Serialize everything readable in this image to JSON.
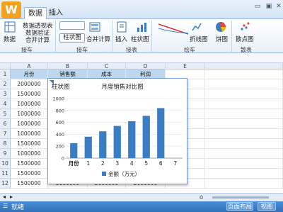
{
  "app": {
    "logo_letter": "W"
  },
  "tabs": [
    {
      "label": "数据"
    },
    {
      "label": "插入"
    }
  ],
  "ribbon": {
    "data_btn": "数据",
    "pivot": "数据透视表",
    "validate": "数据验证",
    "merge_calc_top": "合并计算",
    "group_label_1": "接车",
    "gen_graph": "柱状图",
    "merge_calc": "合并计算",
    "group_label_2": "接车",
    "insert": "插入",
    "bar_chart": "柱状图",
    "group_label_3": "接表",
    "line_chart": "折线图",
    "pie_chart": "饼图",
    "group_label_4": "绘车",
    "scatter": "散点图",
    "group_label_5": "散表"
  },
  "grid": {
    "columns": [
      "A",
      "B",
      "C",
      "D",
      "E"
    ],
    "rows": [
      "1",
      "2",
      "3",
      "4",
      "5",
      "6",
      "7",
      "8",
      "9",
      "10",
      "11",
      "12"
    ],
    "header_row": [
      "月份",
      "销售额",
      "成本",
      "利润"
    ],
    "col_a": [
      "2000000",
      "1500000",
      "1000000",
      "1000000",
      "1000000",
      "1000000",
      "1500000",
      "1000000",
      "1500000",
      "1500000",
      "1500000"
    ],
    "row12": [
      "1500000",
      "2000000",
      "2000000",
      "2000000"
    ]
  },
  "chart_data": {
    "type": "bar",
    "tag": "柱状图",
    "title": "月度销售对比图",
    "categories": [
      "月份",
      "1",
      "2",
      "3",
      "4",
      "5",
      "6",
      "7"
    ],
    "series": [
      {
        "name": "金额（万元）",
        "values": [
          250,
          360,
          450,
          540,
          620,
          710,
          840
        ]
      }
    ],
    "y_ticks": [
      0,
      200,
      400,
      600,
      800,
      1000
    ],
    "ylim": [
      0,
      1000
    ],
    "color": "#3a7dc2"
  },
  "status": {
    "left": "就绪",
    "layout": "页面布局",
    "view": "视图"
  }
}
